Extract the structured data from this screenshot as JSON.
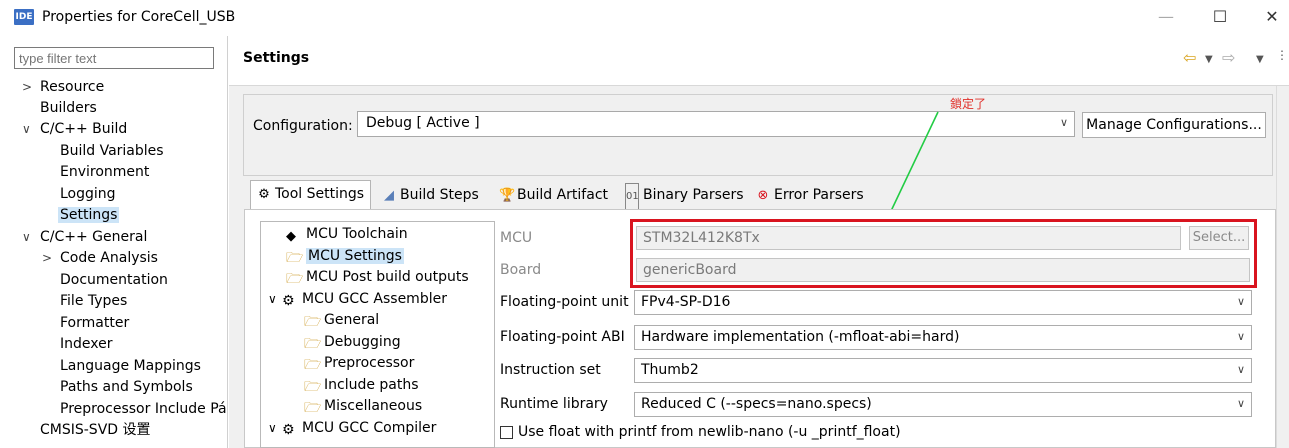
{
  "window": {
    "icon_text": "IDE",
    "title": "Properties for CoreCell_USB",
    "minimize": "—",
    "maximize": "☐",
    "close": "✕"
  },
  "filter": {
    "placeholder": "type filter text"
  },
  "tree": [
    {
      "label": "Resource",
      "toggle": ">"
    },
    {
      "label": "Builders",
      "toggle": ""
    },
    {
      "label": "C/C++ Build",
      "toggle": "∨"
    },
    {
      "label": "Build Variables",
      "toggle": ""
    },
    {
      "label": "Environment",
      "toggle": ""
    },
    {
      "label": "Logging",
      "toggle": ""
    },
    {
      "label": "Settings",
      "toggle": "",
      "selected": true
    },
    {
      "label": "C/C++ General",
      "toggle": "∨"
    },
    {
      "label": "Code Analysis",
      "toggle": ">"
    },
    {
      "label": "Documentation",
      "toggle": ""
    },
    {
      "label": "File Types",
      "toggle": ""
    },
    {
      "label": "Formatter",
      "toggle": ""
    },
    {
      "label": "Indexer",
      "toggle": ""
    },
    {
      "label": "Language Mappings",
      "toggle": ""
    },
    {
      "label": "Paths and Symbols",
      "toggle": ""
    },
    {
      "label": "Preprocessor Include Pá",
      "toggle": ""
    },
    {
      "label": "CMSIS-SVD 设置",
      "toggle": ""
    }
  ],
  "header": {
    "title": "Settings"
  },
  "config": {
    "label": "Configuration:",
    "value": "Debug  [ Active ]",
    "manage_button": "Manage Configurations..."
  },
  "annotation": "鎖定了",
  "tabs": [
    {
      "label": "Tool Settings",
      "icon": "gear-icon",
      "active": true
    },
    {
      "label": "Build Steps",
      "icon": "steps-icon"
    },
    {
      "label": "Build Artifact",
      "icon": "trophy-icon"
    },
    {
      "label": "Binary Parsers",
      "icon": "binary-icon"
    },
    {
      "label": "Error Parsers",
      "icon": "error-icon"
    }
  ],
  "tool_tree": [
    {
      "label": "MCU Toolchain",
      "icon": "diamond-icon"
    },
    {
      "label": "MCU Settings",
      "icon": "folder-gear-icon",
      "selected": true
    },
    {
      "label": "MCU Post build outputs",
      "icon": "folder-gear-icon"
    },
    {
      "label": "MCU GCC Assembler",
      "icon": "gear-icon",
      "toggle": "∨"
    },
    {
      "label": "General",
      "icon": "folder-gear-icon"
    },
    {
      "label": "Debugging",
      "icon": "folder-gear-icon"
    },
    {
      "label": "Preprocessor",
      "icon": "folder-gear-icon"
    },
    {
      "label": "Include paths",
      "icon": "folder-gear-icon"
    },
    {
      "label": "Miscellaneous",
      "icon": "folder-gear-icon"
    },
    {
      "label": "MCU GCC Compiler",
      "icon": "gear-icon",
      "toggle": "∨"
    }
  ],
  "fields": {
    "mcu_label": "MCU",
    "mcu_value": "STM32L412K8Tx",
    "select_button": "Select...",
    "board_label": "Board",
    "board_value": "genericBoard",
    "fpu_label": "Floating-point unit",
    "fpu_value": "FPv4-SP-D16",
    "abi_label": "Floating-point ABI",
    "abi_value": "Hardware implementation (-mfloat-abi=hard)",
    "iset_label": "Instruction set",
    "iset_value": "Thumb2",
    "runtime_label": "Runtime library",
    "runtime_value": "Reduced C (--specs=nano.specs)",
    "printf_float_label": "Use float with printf from newlib-nano (-u _printf_float)",
    "printf_float_checked": false
  },
  "colors": {
    "selection": "#cce4f7",
    "highlight_box": "#d9141f",
    "arrow": "#22cc44",
    "annotation": "#e0302a"
  }
}
